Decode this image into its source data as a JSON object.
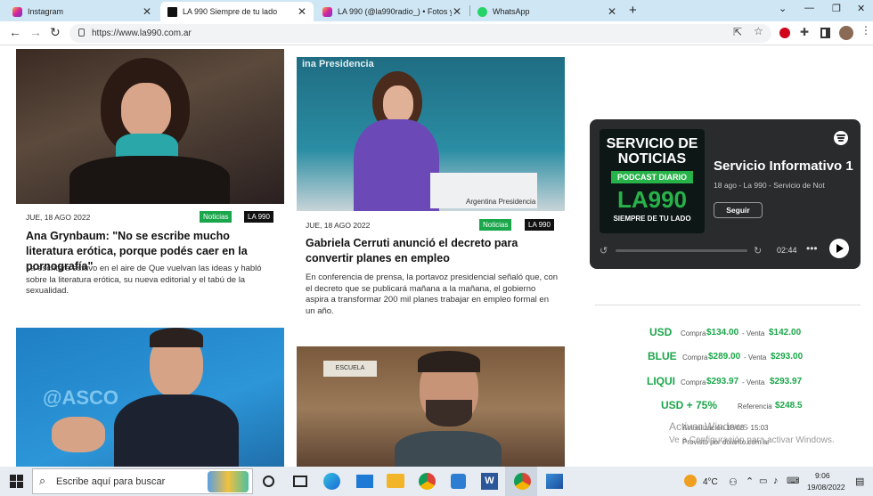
{
  "browser": {
    "tabs": [
      {
        "label": "Instagram",
        "icon": "instagram-icon",
        "active": false
      },
      {
        "label": "LA 990 Siempre de tu lado",
        "icon": "la990-icon",
        "active": true
      },
      {
        "label": "LA 990 (@la990radio_) • Fotos y v",
        "icon": "instagram-icon",
        "active": false
      },
      {
        "label": "WhatsApp",
        "icon": "whatsapp-icon",
        "active": false
      }
    ],
    "url": "https://www.la990.com.ar",
    "close_glyph": "✕",
    "newtab_glyph": "+"
  },
  "articles": [
    {
      "date": "JUE, 18 AGO 2022",
      "tag1": "Noticias",
      "tag2": "LA 990",
      "title": "Ana Grynbaum: \"No se escribe mucho literatura erótica, porque podés caer en la pornografía\"",
      "summary": "La escritora estuvo en el aire de Que vuelvan las ideas y habló sobre la literatura erótica, su nueva editorial y el tabú de la sexualidad."
    },
    {
      "date": "JUE, 18 AGO 2022",
      "tag1": "Noticias",
      "tag2": "LA 990",
      "title": "Gabriela Cerruti anunció el decreto para convertir planes en empleo",
      "summary": "En conferencia de prensa, la portavoz presidencial señaló que, con el decreto que se publicará mañana a la mañana, el gobierno aspira a transformar 200 mil planes trabajar en empleo formal en un año.",
      "photo_text": "Argentina Presidencia",
      "bg_text": "ina Presidencia"
    },
    {
      "photo_text": "@ASCO"
    },
    {
      "photo_text": "ESCUELA"
    }
  ],
  "podcast": {
    "cover_line1": "SERVICIO DE",
    "cover_line2": "NOTICIAS",
    "cover_badge": "PODCAST DIARIO",
    "cover_logo": "LA990",
    "cover_slogan": "SIEMPRE DE TU LADO",
    "title": "Servicio Informativo 1",
    "subtitle": "18 ago - La 990 - Servicio de Not",
    "follow": "Seguir",
    "time": "02:44",
    "more": "•••"
  },
  "currency": [
    {
      "name": "USD",
      "compra_label": "Compra",
      "compra": "$134.00",
      "venta_label": "- Venta",
      "venta": "$142.00"
    },
    {
      "name": "BLUE",
      "compra_label": "Compra",
      "compra": "$289.00",
      "venta_label": "- Venta",
      "venta": "$293.00"
    },
    {
      "name": "LIQUI",
      "compra_label": "Compra",
      "compra": "$293.97",
      "venta_label": "- Venta",
      "venta": "$293.97"
    },
    {
      "name": "USD + 75%",
      "compra_label": "Referencia",
      "compra": "$248.5"
    }
  ],
  "update_text": "Actualización 18/08 - 15:03",
  "provider_text": "Provisto por dolarito.com.ar",
  "watermark": {
    "line1": "Activar Windows",
    "line2": "Ve a Configuración para activar Windows."
  },
  "taskbar": {
    "search_placeholder": "Escribe aquí para buscar",
    "weather": "4°C",
    "time": "9:06",
    "date": "19/08/2022"
  },
  "colors": {
    "accent_green": "#1aa64a",
    "tab_bar": "#cfe6f5",
    "podcast_bg": "#292b2d"
  }
}
